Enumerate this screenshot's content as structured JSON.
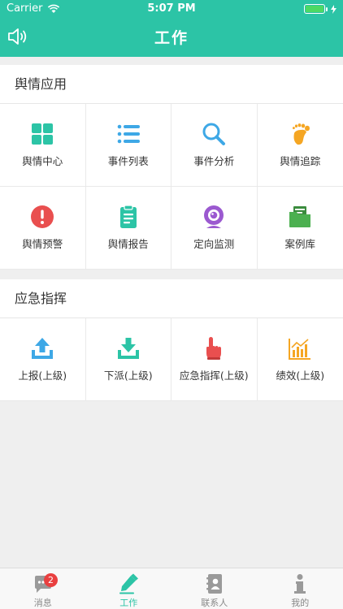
{
  "status_bar": {
    "carrier": "Carrier",
    "time": "5:07 PM"
  },
  "header": {
    "title": "工作"
  },
  "sections": [
    {
      "title": "舆情应用",
      "items": [
        {
          "label": "舆情中心",
          "icon": "grid-icon",
          "color": "#2cc4a6"
        },
        {
          "label": "事件列表",
          "icon": "list-icon",
          "color": "#3ea8e6"
        },
        {
          "label": "事件分析",
          "icon": "magnifier-icon",
          "color": "#3ea8e6"
        },
        {
          "label": "舆情追踪",
          "icon": "footprint-icon",
          "color": "#f5a623"
        },
        {
          "label": "舆情预警",
          "icon": "alert-icon",
          "color": "#e94f4f"
        },
        {
          "label": "舆情报告",
          "icon": "clipboard-icon",
          "color": "#2cc4a6"
        },
        {
          "label": "定向监测",
          "icon": "webcam-icon",
          "color": "#9b59d0"
        },
        {
          "label": "案例库",
          "icon": "folder-icon",
          "color": "#4cb050"
        }
      ]
    },
    {
      "title": "应急指挥",
      "items": [
        {
          "label": "上报(上级)",
          "icon": "upload-icon",
          "color": "#3ea8e6"
        },
        {
          "label": "下派(上级)",
          "icon": "download-icon",
          "color": "#2cc4a6"
        },
        {
          "label": "应急指挥(上级)",
          "icon": "pointer-hand-icon",
          "color": "#e94f4f"
        },
        {
          "label": "绩效(上级)",
          "icon": "bar-chart-icon",
          "color": "#f5a623"
        }
      ]
    }
  ],
  "tabbar": {
    "tabs": [
      {
        "label": "消息",
        "icon": "chat-icon",
        "badge": "2"
      },
      {
        "label": "工作",
        "icon": "pen-icon",
        "active": true
      },
      {
        "label": "联系人",
        "icon": "contacts-icon"
      },
      {
        "label": "我的",
        "icon": "info-person-icon"
      }
    ]
  },
  "colors": {
    "accent": "#2cc4a6",
    "badge": "#e94040"
  }
}
